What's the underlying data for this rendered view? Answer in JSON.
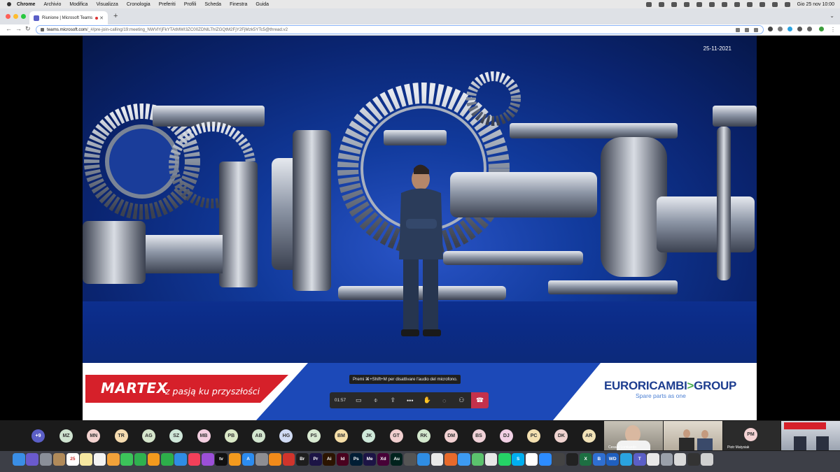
{
  "menubar": {
    "app_name": "Chrome",
    "items": [
      "Archivio",
      "Modifica",
      "Visualizza",
      "Cronologia",
      "Preferiti",
      "Profili",
      "Scheda",
      "Finestra",
      "Guida"
    ],
    "clock": "Gio 25 nov  10:00",
    "status_icons": [
      "creative-cloud-icon",
      "keyboard-icon",
      "flag-icon",
      "security-icon",
      "clipboard-icon",
      "shield-icon",
      "bluetooth-icon",
      "battery-icon",
      "wifi-icon",
      "search-icon",
      "user-icon",
      "control-center-icon"
    ]
  },
  "browser": {
    "tab_title": "Riunione | Microsoft Teams",
    "new_tab_symbol": "+",
    "url_host": "teams.microsoft.com",
    "url_path": "/_#/pre-join-calling/19:meeting_NWVlYjFkYTAtMWI3ZC00ZDNlLThlZGQtM2FjY2FjMzk5YTc5@thread.v2"
  },
  "slide": {
    "date": "25-11-2021",
    "martex_name": "MARTEX",
    "martex_tagline": "z pasją ku przyszłości",
    "euro_name": "EURORICAMBI",
    "euro_arrow": ">",
    "euro_group": "GROUP",
    "euro_tagline": "Spare parts as one",
    "colors": {
      "martex_red": "#d6202a",
      "euro_blue": "#1d3d8f",
      "euro_green": "#4caf50"
    }
  },
  "call": {
    "tooltip": "Premi ⌘+Shift+M per disattivare l'audio del microfono.",
    "timer": "01:57",
    "buttons": [
      "camera-off-icon",
      "mic-off-icon",
      "share-icon",
      "more-icon",
      "raise-hand-icon",
      "chat-icon",
      "participants-icon"
    ],
    "leave_color": "#c4314b"
  },
  "participants": {
    "overflow": "+9",
    "avatars": [
      {
        "initials": "MZ",
        "color": "#cfe3d0"
      },
      {
        "initials": "MN",
        "color": "#f3d3d0"
      },
      {
        "initials": "TR",
        "color": "#f6dcb0"
      },
      {
        "initials": "AG",
        "color": "#d6e6cc"
      },
      {
        "initials": "SZ",
        "color": "#cfe7d9"
      },
      {
        "initials": "MB",
        "color": "#f3cfe0"
      },
      {
        "initials": "PB",
        "color": "#dbe9c7"
      },
      {
        "initials": "AB",
        "color": "#d3e6cf"
      },
      {
        "initials": "HG",
        "color": "#d0dbf3"
      },
      {
        "initials": "PS",
        "color": "#d9ead2"
      },
      {
        "initials": "BM",
        "color": "#f6dfa8"
      },
      {
        "initials": "JK",
        "color": "#cfe9da"
      },
      {
        "initials": "GT",
        "color": "#f1cfcf"
      },
      {
        "initials": "RK",
        "color": "#d3e8cd"
      },
      {
        "initials": "DM",
        "color": "#f3d2d3"
      },
      {
        "initials": "BS",
        "color": "#f0d2d8"
      },
      {
        "initials": "DJ",
        "color": "#f1d0e4"
      },
      {
        "initials": "PC",
        "color": "#f4e0b0"
      },
      {
        "initials": "DK",
        "color": "#f1d4d0"
      },
      {
        "initials": "AR",
        "color": "#f2e3b8"
      }
    ],
    "video_tiles": [
      {
        "name": "Cesare Lombardo"
      },
      {
        "name": ""
      },
      {
        "name": ""
      }
    ],
    "pm_initials": "PM",
    "pm_name": "Piotr Matysiak",
    "pm_color": "#f3d2d3"
  },
  "dock": {
    "apps": [
      {
        "name": "finder-icon",
        "color": "#3a8ee6",
        "label": ""
      },
      {
        "name": "siri-icon",
        "color": "#6a5acd",
        "label": ""
      },
      {
        "name": "launchpad-icon",
        "color": "#8a8f99",
        "label": ""
      },
      {
        "name": "contacts-icon",
        "color": "#b08a5a",
        "label": ""
      },
      {
        "name": "calendar-icon",
        "color": "#ffffff",
        "label": "25"
      },
      {
        "name": "notes-icon",
        "color": "#f5e7a1",
        "label": ""
      },
      {
        "name": "reminders-icon",
        "color": "#f3f3f3",
        "label": ""
      },
      {
        "name": "photos-icon",
        "color": "#f2a23a",
        "label": ""
      },
      {
        "name": "messages-icon",
        "color": "#3cc45a",
        "label": ""
      },
      {
        "name": "facetime-icon",
        "color": "#2fb14f",
        "label": ""
      },
      {
        "name": "pages-icon",
        "color": "#f39a1e",
        "label": ""
      },
      {
        "name": "numbers-icon",
        "color": "#2dae4a",
        "label": ""
      },
      {
        "name": "keynote-icon",
        "color": "#2f8de4",
        "label": ""
      },
      {
        "name": "music-icon",
        "color": "#f2405a",
        "label": ""
      },
      {
        "name": "podcasts-icon",
        "color": "#9b4fd8",
        "label": ""
      },
      {
        "name": "tv-icon",
        "color": "#111111",
        "label": "tv"
      },
      {
        "name": "books-icon",
        "color": "#f39a1e",
        "label": ""
      },
      {
        "name": "app-store-icon",
        "color": "#2c8cf0",
        "label": "A"
      },
      {
        "name": "settings-icon",
        "color": "#8e8e93",
        "label": ""
      },
      {
        "name": "vlc-icon",
        "color": "#f18a1a",
        "label": ""
      },
      {
        "name": "acrobat-icon",
        "color": "#d0342c",
        "label": ""
      },
      {
        "name": "bridge-icon",
        "color": "#1e1e1e",
        "label": "Br"
      },
      {
        "name": "premiere-icon",
        "color": "#1c1445",
        "label": "Pr"
      },
      {
        "name": "illustrator-icon",
        "color": "#2b1400",
        "label": "Ai"
      },
      {
        "name": "indesign-icon",
        "color": "#49021f",
        "label": "Id"
      },
      {
        "name": "photoshop-icon",
        "color": "#001d34",
        "label": "Ps"
      },
      {
        "name": "media-encoder-icon",
        "color": "#1c1445",
        "label": "Me"
      },
      {
        "name": "xd-icon",
        "color": "#470137",
        "label": "Xd"
      },
      {
        "name": "audition-icon",
        "color": "#00221d",
        "label": "Au"
      },
      {
        "name": "calculator-icon",
        "color": "#555555",
        "label": ""
      },
      {
        "name": "safari-icon",
        "color": "#2f8de4",
        "label": ""
      },
      {
        "name": "chrome-icon",
        "color": "#e9e9e9",
        "label": ""
      },
      {
        "name": "firefox-icon",
        "color": "#e86a2b",
        "label": ""
      },
      {
        "name": "mail-icon",
        "color": "#3d9bf2",
        "label": ""
      },
      {
        "name": "maps-icon",
        "color": "#5bc26d",
        "label": ""
      },
      {
        "name": "preview-icon",
        "color": "#e8e8e8",
        "label": ""
      },
      {
        "name": "whatsapp-icon",
        "color": "#25d366",
        "label": ""
      },
      {
        "name": "skype-icon",
        "color": "#00aff0",
        "label": "S"
      },
      {
        "name": "slack-icon",
        "color": "#ffffff",
        "label": ""
      },
      {
        "name": "zoom-icon",
        "color": "#2d8cff",
        "label": ""
      },
      {
        "name": "screenshot-icon",
        "color": "#444444",
        "label": ""
      },
      {
        "name": "terminal-icon",
        "color": "#222222",
        "label": ""
      },
      {
        "name": "excel-icon",
        "color": "#1d6f42",
        "label": "X"
      },
      {
        "name": "bbedit-icon",
        "color": "#2f6fd1",
        "label": "B"
      },
      {
        "name": "wd-icon",
        "color": "#1f5fbf",
        "label": "WD"
      },
      {
        "name": "telegram-icon",
        "color": "#2aa3e0",
        "label": ""
      },
      {
        "name": "teams-icon",
        "color": "#5b5fc7",
        "label": "T"
      },
      {
        "name": "doc-icon",
        "color": "#e8e8e8",
        "label": ""
      },
      {
        "name": "downloads-icon",
        "color": "#9aa0aa",
        "label": ""
      },
      {
        "name": "folder-icon",
        "color": "#d9d9d9",
        "label": ""
      },
      {
        "name": "window-icon",
        "color": "#333333",
        "label": ""
      },
      {
        "name": "trash-icon",
        "color": "#d0d0d0",
        "label": ""
      }
    ]
  }
}
